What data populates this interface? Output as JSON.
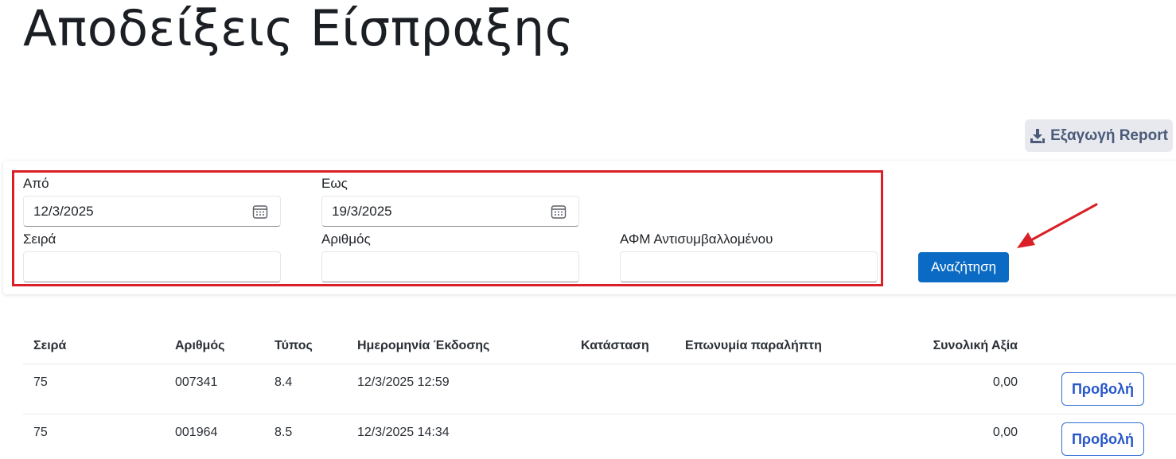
{
  "page": {
    "title": "Αποδείξεις Είσπραξης"
  },
  "toolbar": {
    "export_label": "Εξαγωγή Report"
  },
  "filters": {
    "from_label": "Από",
    "from_value": "12/3/2025",
    "to_label": "Εως",
    "to_value": "19/3/2025",
    "series_label": "Σειρά",
    "series_value": "",
    "number_label": "Αριθμός",
    "number_value": "",
    "vat_label": "ΑΦΜ Αντισυμβαλλομένου",
    "vat_value": "",
    "search_label": "Αναζήτηση"
  },
  "table": {
    "columns": {
      "series": "Σειρά",
      "number": "Αριθμός",
      "type": "Τύπος",
      "issue_date": "Ημερομηνία Έκδοσης",
      "status": "Κατάσταση",
      "recipient": "Επωνυμία παραλήπτη",
      "total": "Συνολική Αξία"
    },
    "rows": [
      {
        "series": "75",
        "number": "007341",
        "type": "8.4",
        "issue_date": "12/3/2025 12:59",
        "status": "",
        "recipient": "",
        "total": "0,00",
        "action": "Προβολή"
      },
      {
        "series": "75",
        "number": "001964",
        "type": "8.5",
        "issue_date": "12/3/2025 14:34",
        "status": "",
        "recipient": "",
        "total": "0,00",
        "action": "Προβολή"
      }
    ]
  },
  "colors": {
    "primary": "#0b6bc4",
    "highlight": "#d92027",
    "export_bg": "#e7e9ee"
  },
  "icons": {
    "export": "download-icon",
    "calendar": "calendar-icon",
    "annotation": "red-arrow-icon"
  }
}
